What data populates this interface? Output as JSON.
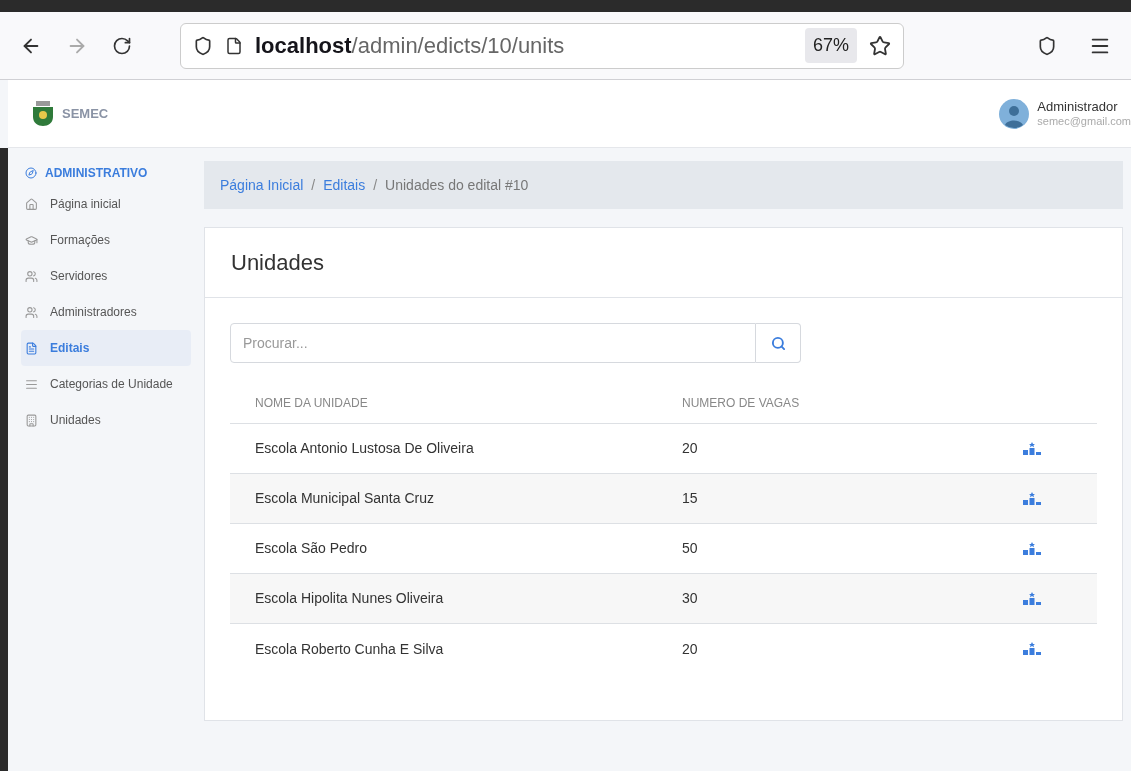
{
  "browser": {
    "url_host": "localhost",
    "url_path": "/admin/edicts/10/units",
    "zoom": "67%"
  },
  "header": {
    "brand": "SEMEC",
    "user_name": "Administrador",
    "user_email": "semec@gmail.com"
  },
  "sidebar": {
    "section": "ADMINISTRATIVO",
    "items": [
      {
        "label": "Página inicial",
        "selected": false
      },
      {
        "label": "Formações",
        "selected": false
      },
      {
        "label": "Servidores",
        "selected": false
      },
      {
        "label": "Administradores",
        "selected": false
      },
      {
        "label": "Editais",
        "selected": true
      },
      {
        "label": "Categorias de Unidade",
        "selected": false
      },
      {
        "label": "Unidades",
        "selected": false
      }
    ]
  },
  "breadcrumb": [
    {
      "label": "Página Inicial",
      "kind": "link"
    },
    {
      "label": "/",
      "kind": "separator"
    },
    {
      "label": "Editais",
      "kind": "link"
    },
    {
      "label": "/",
      "kind": "separator"
    },
    {
      "label": "Unidades do edital #10",
      "kind": "current"
    }
  ],
  "card": {
    "title": "Unidades",
    "search": {
      "placeholder": "Procurar..."
    },
    "table": {
      "columns": [
        "NOME DA UNIDADE",
        "NUMERO DE VAGAS"
      ],
      "rows": [
        {
          "name": "Escola Antonio Lustosa De Oliveira",
          "vagas": "20"
        },
        {
          "name": "Escola Municipal Santa Cruz",
          "vagas": "15"
        },
        {
          "name": "Escola São Pedro",
          "vagas": "50"
        },
        {
          "name": "Escola Hipolita Nunes Oliveira",
          "vagas": "30"
        },
        {
          "name": "Escola Roberto Cunha E Silva",
          "vagas": "20"
        }
      ]
    }
  }
}
